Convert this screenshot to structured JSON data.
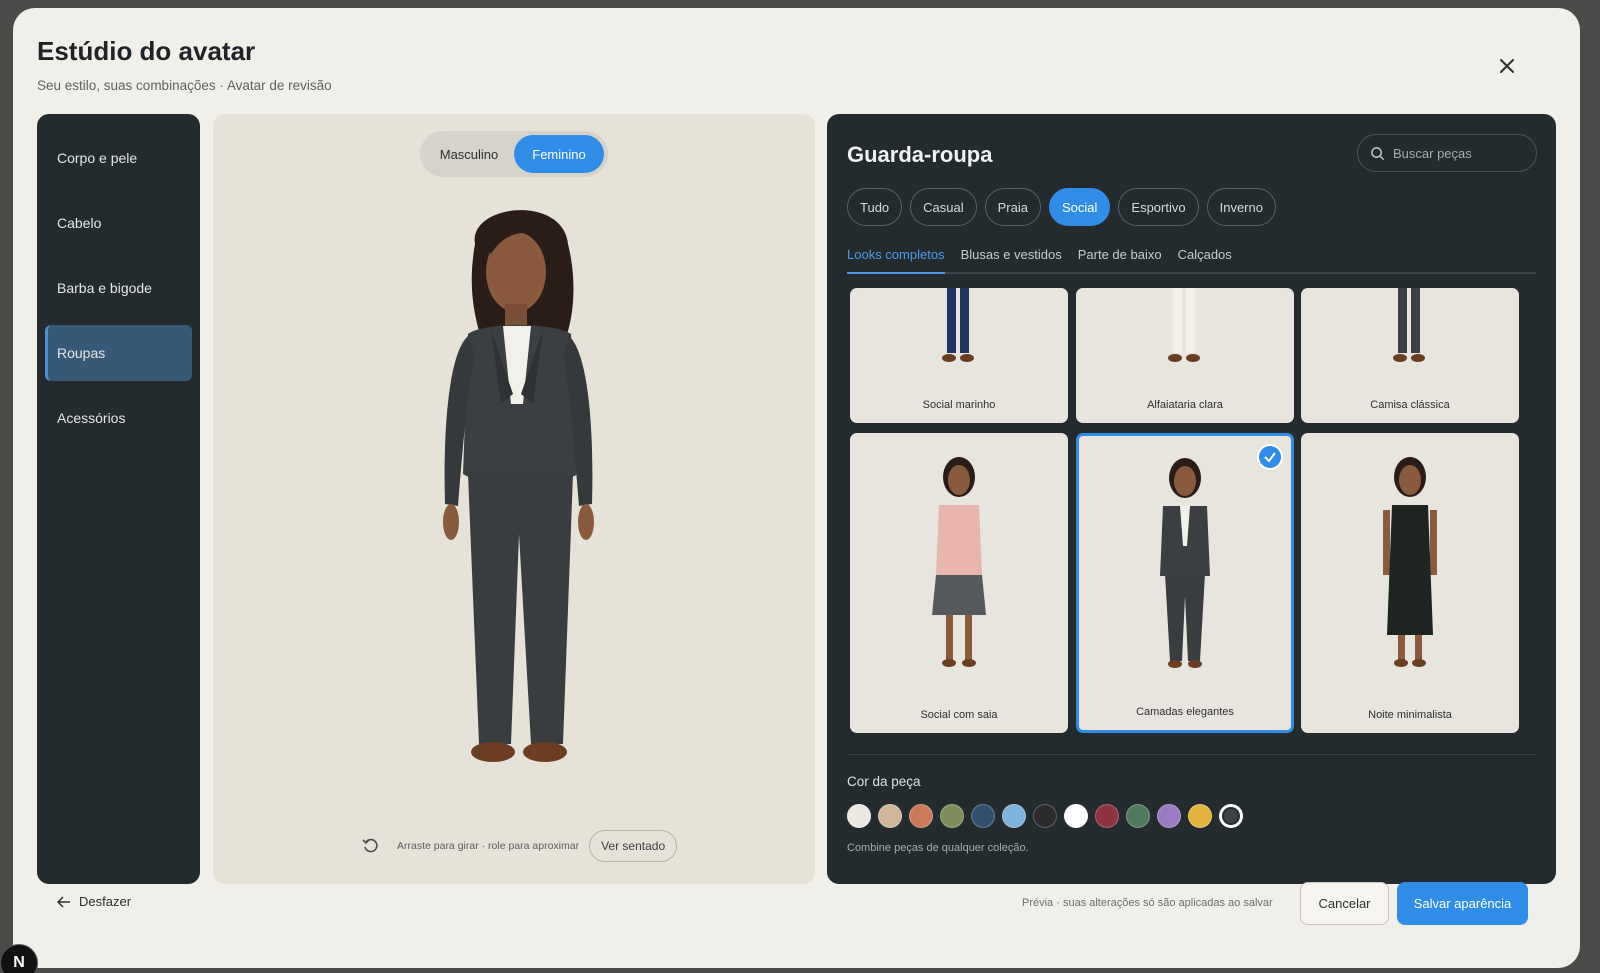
{
  "header": {
    "title": "Estúdio do avatar",
    "subtitle": "Seu estilo, suas combinações · Avatar de revisão"
  },
  "sidebar": {
    "items": [
      {
        "label": "Corpo e pele",
        "active": false
      },
      {
        "label": "Cabelo",
        "active": false
      },
      {
        "label": "Barba e bigode",
        "active": false
      },
      {
        "label": "Roupas",
        "active": true
      },
      {
        "label": "Acessórios",
        "active": false
      }
    ]
  },
  "preview": {
    "gender": {
      "male": "Masculino",
      "female": "Feminino",
      "selected": "Feminino"
    },
    "hint": "Arraste para girar · role para aproximar",
    "seated_button": "Ver sentado"
  },
  "wardrobe": {
    "title": "Guarda-roupa",
    "search_placeholder": "Buscar peças",
    "filters": [
      {
        "label": "Tudo",
        "active": false
      },
      {
        "label": "Casual",
        "active": false
      },
      {
        "label": "Praia",
        "active": false
      },
      {
        "label": "Social",
        "active": true
      },
      {
        "label": "Esportivo",
        "active": false
      },
      {
        "label": "Inverno",
        "active": false
      }
    ],
    "subtabs": [
      {
        "label": "Looks completos",
        "active": true
      },
      {
        "label": "Blusas e vestidos",
        "active": false
      },
      {
        "label": "Parte de baixo",
        "active": false
      },
      {
        "label": "Calçados",
        "active": false
      }
    ],
    "outfits": [
      {
        "label": "Social marinho",
        "selected": false
      },
      {
        "label": "Alfaiataria clara",
        "selected": false
      },
      {
        "label": "Camisa clássica",
        "selected": false
      },
      {
        "label": "Social com saia",
        "selected": false
      },
      {
        "label": "Camadas elegantes",
        "selected": true
      },
      {
        "label": "Noite minimalista",
        "selected": false
      }
    ],
    "color_label": "Cor da peça",
    "colors": [
      "#ece9e2",
      "#cdb89c",
      "#c97a5a",
      "#7f8d5a",
      "#34506f",
      "#7fb2dd",
      "#2b2b2b",
      "#ffffff",
      "#8e3440",
      "#4f7a60",
      "#9a7cc0",
      "#e2b43b",
      "#3e4246"
    ],
    "selected_color": "#3e4246",
    "color_note": "Combine peças de qualquer coleção."
  },
  "footer": {
    "undo": "Desfazer",
    "note": "Prévia · suas alterações só são aplicadas ao salvar",
    "cancel": "Cancelar",
    "save": "Salvar aparência"
  },
  "badge": "N"
}
